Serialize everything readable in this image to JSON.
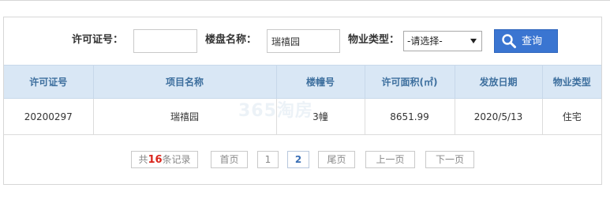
{
  "search": {
    "permit_label": "许可证号：",
    "permit_value": "",
    "project_label": "楼盘名称：",
    "project_value": "瑞禧园",
    "property_type_label": "物业类型：",
    "property_type_selected": "-请选择-",
    "search_button_label": "查询",
    "search_icon": "search-icon"
  },
  "table": {
    "columns": [
      "许可证号",
      "项目名称",
      "楼幢号",
      "许可面积(㎡)",
      "发放日期",
      "物业类型"
    ],
    "rows": [
      [
        "20200297",
        "瑞禧园",
        "3幢",
        "8651.99",
        "2020/5/13",
        "住宅"
      ]
    ]
  },
  "pagination": {
    "total_prefix": "共",
    "total_count": "16",
    "total_suffix": "条记录",
    "first_label": "首页",
    "pages": [
      "1",
      "2"
    ],
    "current_page": "2",
    "last_label": "尾页",
    "prev_label": "上一页",
    "next_label": "下一页"
  },
  "watermark": "365淘房",
  "colors": {
    "header_bg": "#d9e7f5",
    "header_text": "#3d6f9e",
    "button_bg": "#3a75d1",
    "count_red": "#d9251c"
  }
}
